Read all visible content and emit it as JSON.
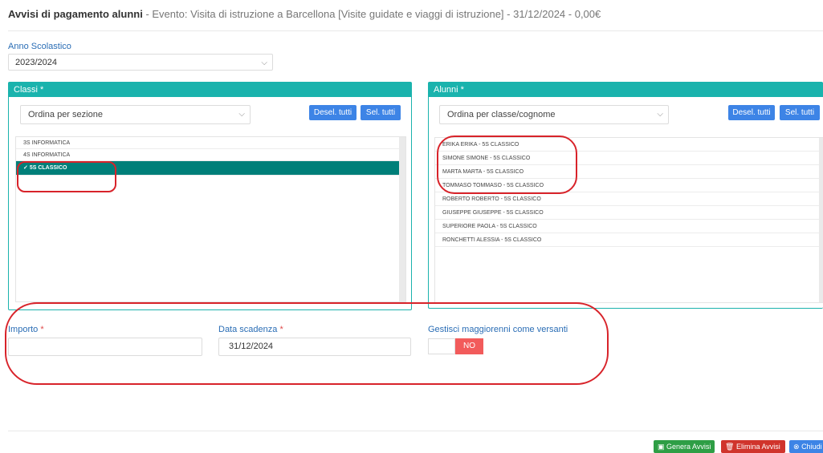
{
  "header": {
    "title": "Avvisi di pagamento alunni",
    "subtitle": " - Evento: Visita di istruzione a Barcellona [Visite guidate e viaggi di istruzione] - 31/12/2024 - 0,00€"
  },
  "anno": {
    "label": "Anno Scolastico",
    "value": "2023/2024"
  },
  "classi": {
    "title": "Classi",
    "required": "*",
    "sort_value": "Ordina per sezione",
    "desel_label": "Desel. tutti",
    "sel_label": "Sel. tutti",
    "check": "✓",
    "items": [
      {
        "label": "3S INFORMATICA",
        "selected": false
      },
      {
        "label": "4S INFORMATICA",
        "selected": false
      },
      {
        "label": "5S CLASSICO",
        "selected": true
      }
    ]
  },
  "alunni": {
    "title": "Alunni",
    "required": "*",
    "sort_value": "Ordina per classe/cognome",
    "desel_label": "Desel. tutti",
    "sel_label": "Sel. tutti",
    "items": [
      "ERIKA ERIKA - 5S CLASSICO",
      "SIMONE SIMONE - 5S CLASSICO",
      "MARTA MARTA - 5S CLASSICO",
      "TOMMASO TOMMASO - 5S CLASSICO",
      "ROBERTO ROBERTO - 5S CLASSICO",
      "GIUSEPPE GIUSEPPE - 5S CLASSICO",
      "SUPERIORE PAOLA - 5S CLASSICO",
      "RONCHETTI ALESSIA - 5S CLASSICO"
    ]
  },
  "form": {
    "importo_label": "Importo",
    "importo_value": "",
    "data_label": "Data scadenza",
    "data_value": "31/12/2024",
    "required": "*",
    "maggiorenni_label": "Gestisci maggiorenni come versanti",
    "toggle_value": "NO"
  },
  "footer": {
    "genera_label": "Genera Avvisi",
    "elimina_label": "Elimina Avvisi",
    "chiudi_label": "Chiudi"
  },
  "colors": {
    "accent": "#1ab3ad",
    "selected_row": "#007f79",
    "primary_button": "#3d84e6",
    "toggle_no": "#f25b5b",
    "annotation": "#d8232a",
    "genera": "#2e9e45",
    "elimina": "#d0342c"
  }
}
